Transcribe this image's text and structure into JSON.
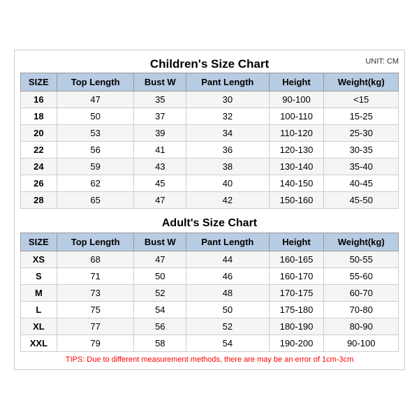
{
  "main_title": "Children's Size Chart",
  "unit": "UNIT: CM",
  "children_headers": [
    "SIZE",
    "Top Length",
    "Bust W",
    "Pant Length",
    "Height",
    "Weight(kg)"
  ],
  "children_rows": [
    [
      "16",
      "47",
      "35",
      "30",
      "90-100",
      "<15"
    ],
    [
      "18",
      "50",
      "37",
      "32",
      "100-110",
      "15-25"
    ],
    [
      "20",
      "53",
      "39",
      "34",
      "110-120",
      "25-30"
    ],
    [
      "22",
      "56",
      "41",
      "36",
      "120-130",
      "30-35"
    ],
    [
      "24",
      "59",
      "43",
      "38",
      "130-140",
      "35-40"
    ],
    [
      "26",
      "62",
      "45",
      "40",
      "140-150",
      "40-45"
    ],
    [
      "28",
      "65",
      "47",
      "42",
      "150-160",
      "45-50"
    ]
  ],
  "adults_title": "Adult's Size Chart",
  "adults_headers": [
    "SIZE",
    "Top Length",
    "Bust W",
    "Pant Length",
    "Height",
    "Weight(kg)"
  ],
  "adults_rows": [
    [
      "XS",
      "68",
      "47",
      "44",
      "160-165",
      "50-55"
    ],
    [
      "S",
      "71",
      "50",
      "46",
      "160-170",
      "55-60"
    ],
    [
      "M",
      "73",
      "52",
      "48",
      "170-175",
      "60-70"
    ],
    [
      "L",
      "75",
      "54",
      "50",
      "175-180",
      "70-80"
    ],
    [
      "XL",
      "77",
      "56",
      "52",
      "180-190",
      "80-90"
    ],
    [
      "XXL",
      "79",
      "58",
      "54",
      "190-200",
      "90-100"
    ]
  ],
  "tips": "TIPS: Due to different measurement methods, there are may be an error of 1cm-3cm"
}
